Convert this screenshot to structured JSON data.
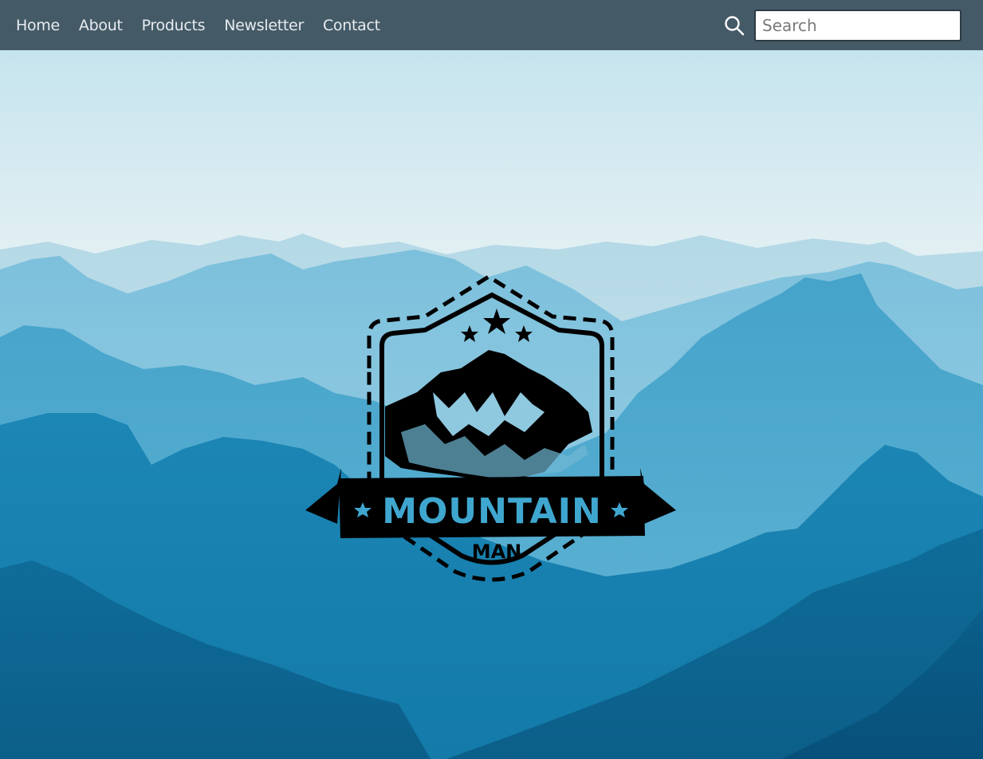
{
  "nav": {
    "items": [
      {
        "label": "Home"
      },
      {
        "label": "About"
      },
      {
        "label": "Products"
      },
      {
        "label": "Newsletter"
      },
      {
        "label": "Contact"
      }
    ]
  },
  "search": {
    "placeholder": "Search",
    "value": ""
  },
  "logo": {
    "line1": "MOUNTAIN",
    "line2": "MAN"
  },
  "colors": {
    "navbar": "#455a67",
    "sky_top": "#c9e6ef",
    "mountain_mid": "#4fa8cc",
    "mountain_dark": "#0f6f9c"
  }
}
